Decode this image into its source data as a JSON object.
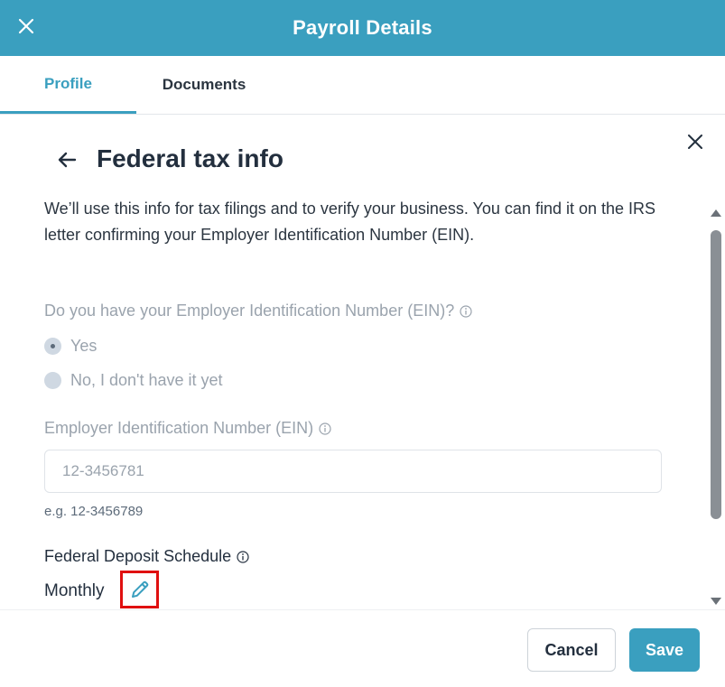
{
  "header": {
    "title": "Payroll Details",
    "close_icon": "close-icon"
  },
  "tabs": [
    {
      "label": "Profile",
      "active": true
    },
    {
      "label": "Documents",
      "active": false
    }
  ],
  "panel": {
    "title": "Federal tax info",
    "description": "We’ll use this info for tax filings and to verify your business. You can find it on the IRS letter confirming your Employer Identification Number (EIN)."
  },
  "ein_question": {
    "label": "Do you have your Employer Identification Number (EIN)?",
    "options": [
      {
        "label": "Yes",
        "selected": true
      },
      {
        "label": "No, I don't have it yet",
        "selected": false
      }
    ]
  },
  "ein_field": {
    "label": "Employer Identification Number (EIN)",
    "value": "12-3456781",
    "hint": "e.g. 12-3456789"
  },
  "deposit_schedule": {
    "label": "Federal Deposit Schedule",
    "value": "Monthly"
  },
  "footer": {
    "cancel_label": "Cancel",
    "save_label": "Save"
  },
  "colors": {
    "brand": "#3a9fbf",
    "highlight": "#e01010",
    "disabled_text": "#9aa3ad"
  }
}
